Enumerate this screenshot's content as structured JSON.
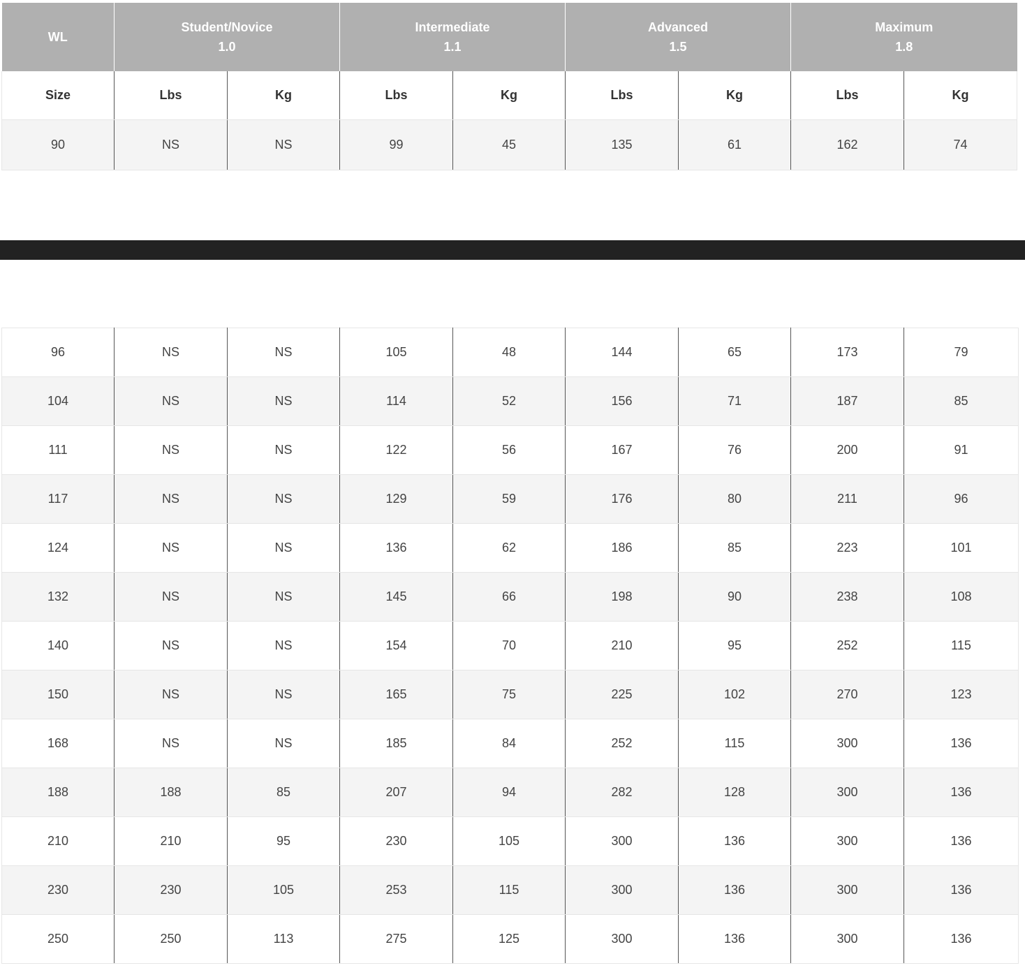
{
  "header": {
    "groups": [
      {
        "label": "WL",
        "value": ""
      },
      {
        "label": "Student/Novice",
        "value": "1.0"
      },
      {
        "label": "Intermediate",
        "value": "1.1"
      },
      {
        "label": "Advanced",
        "value": "1.5"
      },
      {
        "label": "Maximum",
        "value": "1.8"
      }
    ],
    "subheaders": [
      "Size",
      "Lbs",
      "Kg",
      "Lbs",
      "Kg",
      "Lbs",
      "Kg",
      "Lbs",
      "Kg"
    ]
  },
  "top_rows": [
    [
      "90",
      "NS",
      "NS",
      "99",
      "45",
      "135",
      "61",
      "162",
      "74"
    ]
  ],
  "bottom_rows": [
    [
      "96",
      "NS",
      "NS",
      "105",
      "48",
      "144",
      "65",
      "173",
      "79"
    ],
    [
      "104",
      "NS",
      "NS",
      "114",
      "52",
      "156",
      "71",
      "187",
      "85"
    ],
    [
      "111",
      "NS",
      "NS",
      "122",
      "56",
      "167",
      "76",
      "200",
      "91"
    ],
    [
      "117",
      "NS",
      "NS",
      "129",
      "59",
      "176",
      "80",
      "211",
      "96"
    ],
    [
      "124",
      "NS",
      "NS",
      "136",
      "62",
      "186",
      "85",
      "223",
      "101"
    ],
    [
      "132",
      "NS",
      "NS",
      "145",
      "66",
      "198",
      "90",
      "238",
      "108"
    ],
    [
      "140",
      "NS",
      "NS",
      "154",
      "70",
      "210",
      "95",
      "252",
      "115"
    ],
    [
      "150",
      "NS",
      "NS",
      "165",
      "75",
      "225",
      "102",
      "270",
      "123"
    ],
    [
      "168",
      "NS",
      "NS",
      "185",
      "84",
      "252",
      "115",
      "300",
      "136"
    ],
    [
      "188",
      "188",
      "85",
      "207",
      "94",
      "282",
      "128",
      "300",
      "136"
    ],
    [
      "210",
      "210",
      "95",
      "230",
      "105",
      "300",
      "136",
      "300",
      "136"
    ],
    [
      "230",
      "230",
      "105",
      "253",
      "115",
      "300",
      "136",
      "300",
      "136"
    ],
    [
      "250",
      "250",
      "113",
      "275",
      "125",
      "300",
      "136",
      "300",
      "136"
    ]
  ]
}
